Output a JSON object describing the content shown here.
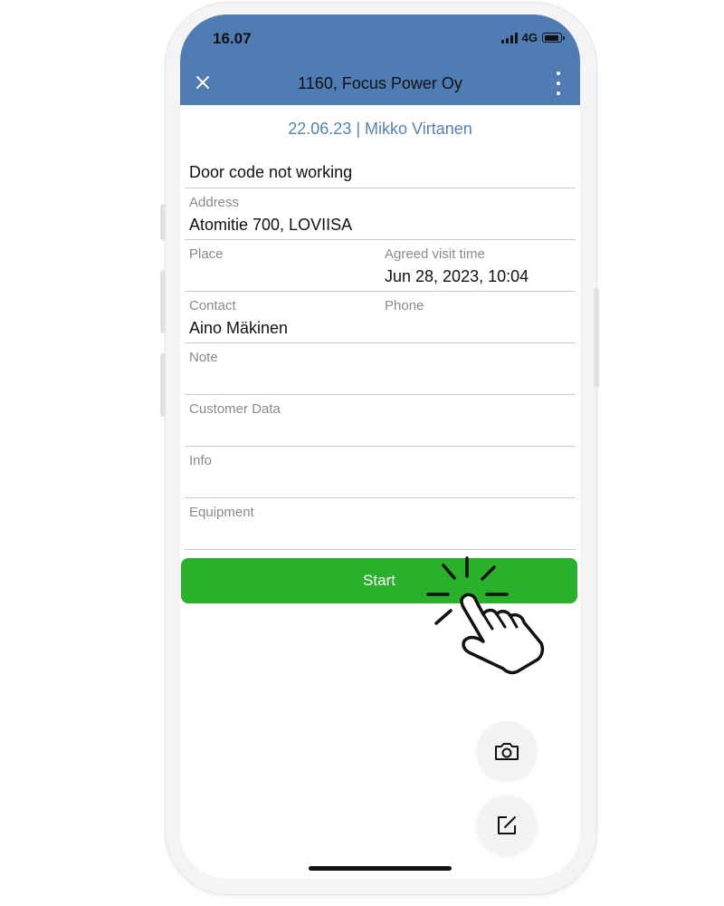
{
  "status_bar": {
    "time": "16.07",
    "network": "4G"
  },
  "header": {
    "title": "1160, Focus Power Oy",
    "close_icon": "close-icon",
    "menu_icon": "more-vertical-icon",
    "color": "#4e7cb3"
  },
  "subheader": "22.06.23 | Mikko Virtanen",
  "task_title": "Door code not working",
  "fields": {
    "address": {
      "label": "Address",
      "value": "Atomitie 700, LOVIISA"
    },
    "place": {
      "label": "Place",
      "value": ""
    },
    "agreed_visit_time": {
      "label": "Agreed visit time",
      "value": "Jun 28, 2023, 10:04"
    },
    "contact": {
      "label": "Contact",
      "value": "Aino Mäkinen"
    },
    "phone": {
      "label": "Phone",
      "value": ""
    },
    "note": {
      "label": "Note",
      "value": ""
    },
    "customer_data": {
      "label": "Customer Data",
      "value": ""
    },
    "info": {
      "label": "Info",
      "value": ""
    },
    "equipment": {
      "label": "Equipment",
      "value": ""
    }
  },
  "start_button": {
    "label": "Start",
    "color": "#29b12b"
  },
  "fabs": {
    "camera_icon": "camera-icon",
    "edit_icon": "edit-icon"
  },
  "overlay": {
    "icon": "tap-hand-icon"
  }
}
